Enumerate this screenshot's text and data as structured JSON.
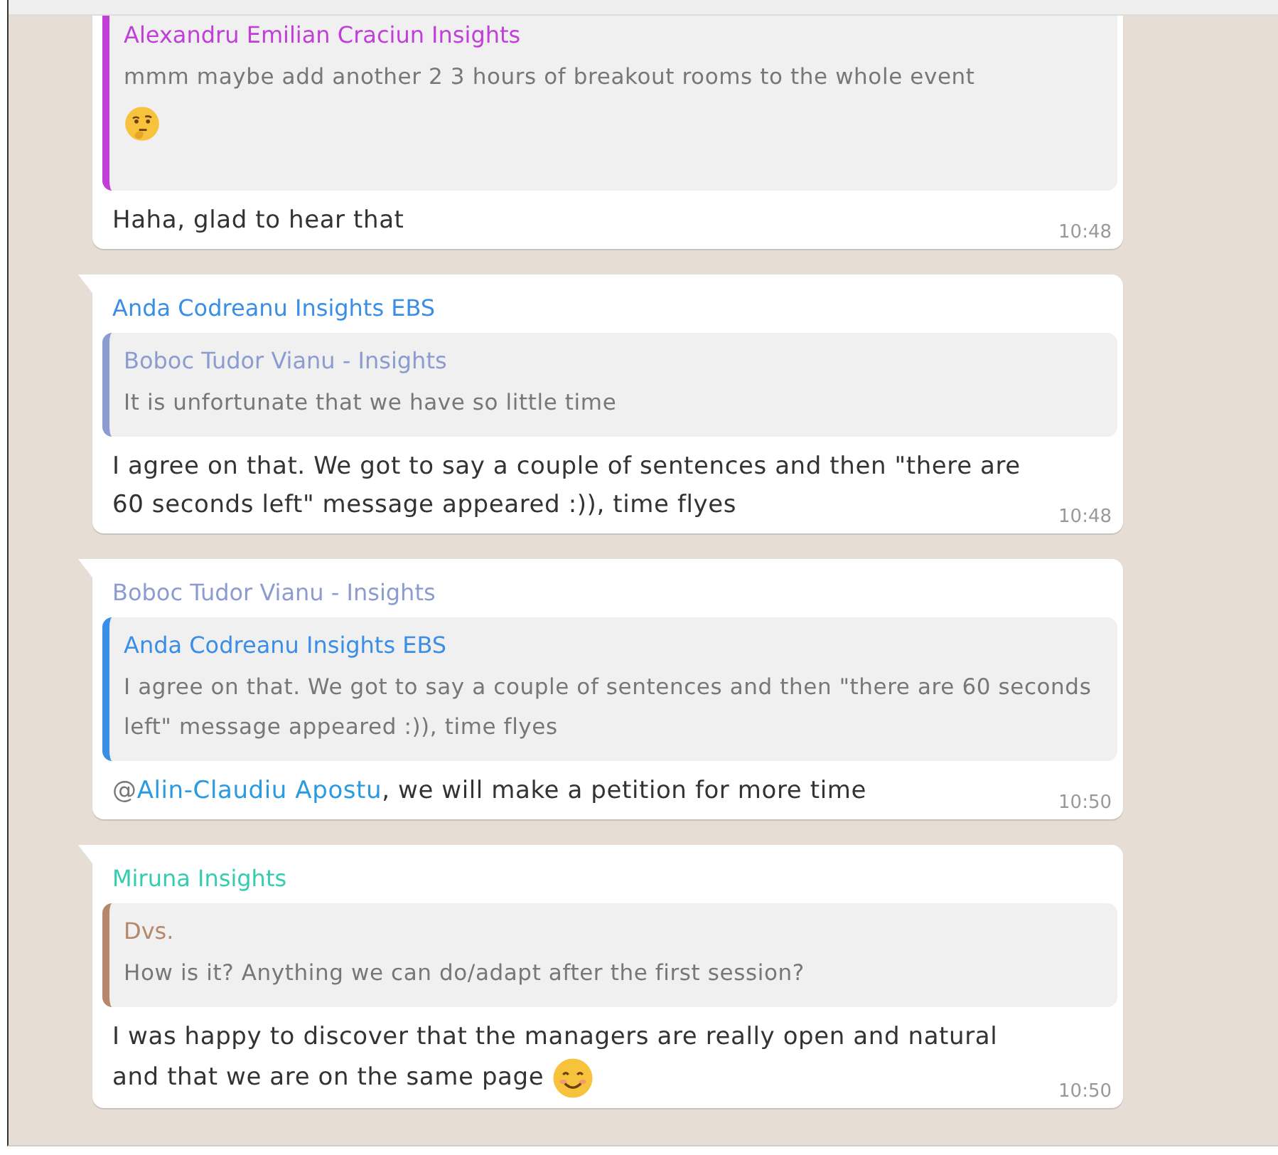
{
  "messages": [
    {
      "kind": "thinking",
      "tail": false,
      "quote": {
        "sender": "Alexandru Emilian Craciun Insights",
        "color": "#c13fd8",
        "text": "mmm maybe add another 2 3 hours of breakout rooms to the whole event"
      },
      "body": [
        {
          "kind": "plain",
          "text": "Haha, glad to hear that"
        }
      ],
      "time": "10:48"
    },
    {
      "kind": "plain",
      "tail": true,
      "sender": "Anda Codreanu Insights EBS",
      "color": "#3a8ee6",
      "quote": {
        "sender": "Boboc Tudor Vianu - Insights",
        "color": "#8c9bd0",
        "text": "It is unfortunate that we have so little time"
      },
      "body": [
        {
          "kind": "plain",
          "text": "I agree on that. We got to say a couple of sentences and then \"there are 60 seconds left\" message appeared :)), time flyes"
        }
      ],
      "time": "10:48"
    },
    {
      "kind": "plain",
      "tail": true,
      "sender": "Boboc Tudor Vianu - Insights",
      "color": "#8c9bd0",
      "quote": {
        "sender": "Anda Codreanu Insights EBS",
        "color": "#3a8ee6",
        "text": "I agree on that. We got to say a couple of sentences and then \"there are 60 seconds left\" message appeared :)), time flyes"
      },
      "body": [
        {
          "kind": "plain",
          "text": "@"
        },
        {
          "kind": "mention",
          "text": "Alin-Claudiu Apostu"
        },
        {
          "kind": "plain",
          "text": ", we will make a petition for more time"
        }
      ],
      "time": "10:50"
    },
    {
      "kind": "smile",
      "tail": true,
      "sender": "Miruna Insights",
      "color": "#35cdb0",
      "quote": {
        "sender": "Dvs.",
        "color": "#b5876b",
        "text": "How is it? Anything we can do/adapt after the first session?"
      },
      "body": [
        {
          "kind": "plain",
          "text": "I was happy to discover that the managers are really open and natural and that we are on the same page"
        }
      ],
      "time": "10:50"
    }
  ]
}
